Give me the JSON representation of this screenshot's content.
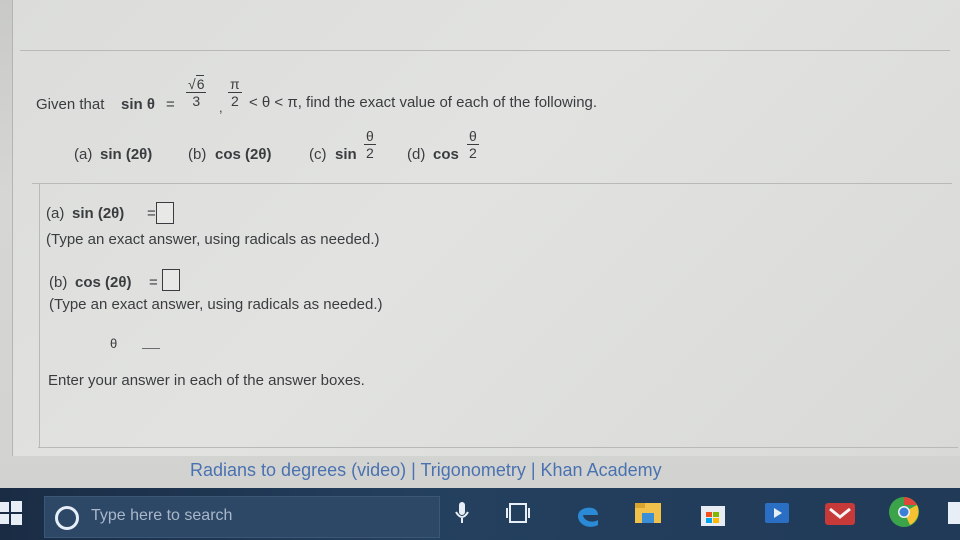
{
  "question": {
    "given_prefix": "Given that",
    "sin_label": "sin θ",
    "equals": "=",
    "sqrt_num": "6",
    "den1": "3",
    "comma": ",",
    "pi_num": "π",
    "den2": "2",
    "inequality": "< θ < π, find the exact value of each of the following."
  },
  "parts": {
    "a": {
      "prefix": "(a)",
      "label": "sin (2θ)"
    },
    "b": {
      "prefix": "(b)",
      "label": "cos (2θ)"
    },
    "c": {
      "prefix": "(c)",
      "label": "sin",
      "num": "θ",
      "den": "2"
    },
    "d": {
      "prefix": "(d)",
      "label": "cos",
      "num": "θ",
      "den": "2"
    }
  },
  "answers": {
    "a": {
      "prefix": "(a)",
      "label": "sin (2θ)",
      "equals": "=",
      "hint": "(Type an exact answer, using radicals as needed.)"
    },
    "b": {
      "prefix": "(b)",
      "label": "cos (2θ)",
      "equals": "=",
      "hint": "(Type an exact answer, using radicals as needed.)"
    },
    "c_partial": "θ",
    "footer": "Enter your answer in each of the answer boxes."
  },
  "link_text": "Radians to degrees (video) | Trigonometry | Khan Academy",
  "taskbar": {
    "search_placeholder": "Type here to search",
    "icons": [
      "microphone-icon",
      "task-view-icon",
      "edge-icon",
      "file-explorer-icon",
      "store-icon",
      "media-player-icon",
      "mail-icon",
      "chrome-icon"
    ]
  },
  "colors": {
    "text": "#3a3d40",
    "link": "#4a72b0",
    "taskbar": "#1f3552",
    "edge": "#2a8ad6",
    "chrome_green": "#3ba44a"
  }
}
